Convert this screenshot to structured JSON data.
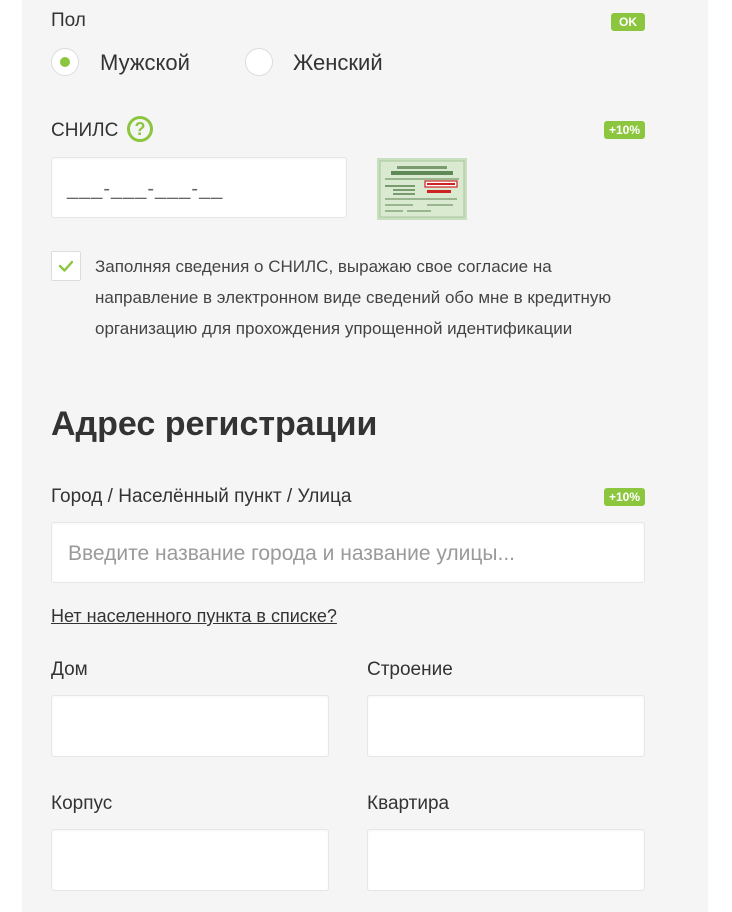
{
  "gender": {
    "label": "Пол",
    "badge": "OK",
    "options": [
      {
        "label": "Мужской",
        "selected": true
      },
      {
        "label": "Женский",
        "selected": false
      }
    ]
  },
  "snils": {
    "label": "СНИЛС",
    "help_icon": "?",
    "badge": "+10%",
    "mask": "___-___-___-__",
    "card_image": "snils-card-image"
  },
  "consent": {
    "checked": true,
    "lines": [
      "Заполняя сведения о СНИЛС, выражаю свое согласие на",
      "направление в электронном виде сведений обо мне в кредитную",
      "организацию для прохождения упрощенной идентификации"
    ]
  },
  "address": {
    "title": "Адрес регистрации",
    "city_label": "Город / Населённый пункт / Улица",
    "city_badge": "+10%",
    "city_placeholder": "Введите название города и название улицы...",
    "no_city_link": "Нет населенного пункта в списке?",
    "house_label": "Дом",
    "building_label": "Строение",
    "block_label": "Корпус",
    "apartment_label": "Квартира"
  },
  "colors": {
    "accent": "#8cc63f",
    "panel_bg": "#f5f5f5"
  }
}
